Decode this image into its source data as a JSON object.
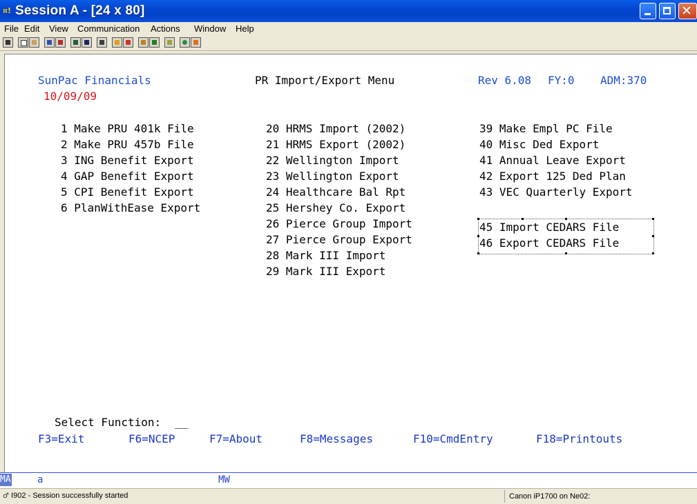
{
  "window": {
    "title": "Session A - [24 x 80]"
  },
  "menubar": [
    "File",
    "Edit",
    "View",
    "Communication",
    "Actions",
    "Window",
    "Help"
  ],
  "terminal": {
    "company": "SunPac Financials",
    "date": "10/09/09",
    "screen_title": "PR Import/Export Menu",
    "rev": "Rev 6.08",
    "fy": "FY:0",
    "adm": "ADM:370",
    "col1": [
      "1 Make PRU 401k File",
      "2 Make PRU 457b File",
      "3 ING Benefit Export",
      "4 GAP Benefit Export",
      "5 CPI Benefit Export",
      "6 PlanWithEase Export"
    ],
    "col2": [
      "20 HRMS Import (2002)",
      "21 HRMS Export (2002)",
      "22 Wellington Import",
      "23 Wellington Export",
      "24 Healthcare Bal Rpt",
      "25 Hershey Co. Export",
      "26 Pierce Group Import",
      "27 Pierce Group Export",
      "28 Mark III Import",
      "29 Mark III Export"
    ],
    "col3": [
      "39 Make Empl PC File",
      "40 Misc Ded Export",
      "41 Annual Leave Export",
      "42 Export 125 Ded Plan",
      "43 VEC Quarterly Export"
    ],
    "col3b": [
      "45 Import CEDARS File",
      "46 Export CEDARS File"
    ],
    "prompt_label": "Select Function:",
    "prompt_value": "__",
    "fkeys": [
      "F3=Exit",
      "F6=NCEP",
      "F7=About",
      "F8=Messages",
      "F10=CmdEntry",
      "F18=Printouts"
    ]
  },
  "oia": {
    "ma": "MA",
    "a": "a",
    "mw": "MW"
  },
  "status": {
    "message": "I902 - Session successfully started",
    "printer": "Canon iP1700 on Ne02:"
  }
}
